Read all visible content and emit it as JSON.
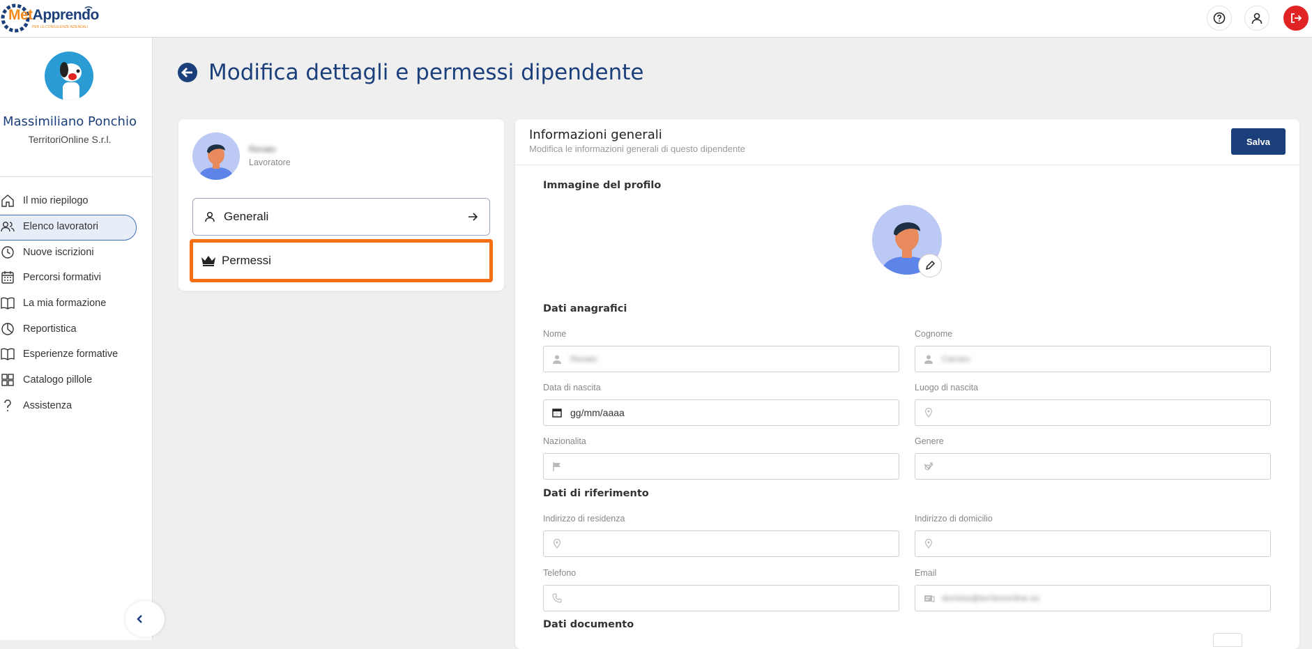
{
  "brand": {
    "logo_met": "Met",
    "logo_app": "Apprendo",
    "logo_sub": "PER LE CONSULENZE AZIENDALI"
  },
  "header": {
    "help_icon": "question-circle-icon",
    "account_icon": "user-icon",
    "logout_icon": "logout-icon",
    "logout_color": "#e02424"
  },
  "sidebar": {
    "user_name": "Massimiliano Ponchio",
    "company": "TerritoriOnline S.r.l.",
    "items": [
      {
        "label": "Il mio riepilogo",
        "icon": "home-icon"
      },
      {
        "label": "Elenco lavoratori",
        "icon": "users-icon",
        "active": true
      },
      {
        "label": "Nuove iscrizioni",
        "icon": "clock-icon"
      },
      {
        "label": "Percorsi formativi",
        "icon": "calendar-icon"
      },
      {
        "label": "La mia formazione",
        "icon": "book-icon"
      },
      {
        "label": "Reportistica",
        "icon": "pie-chart-icon"
      },
      {
        "label": "Esperienze formative",
        "icon": "book-open-icon"
      },
      {
        "label": "Catalogo pillole",
        "icon": "grid-icon"
      },
      {
        "label": "Assistenza",
        "icon": "question-icon"
      }
    ]
  },
  "page": {
    "title": "Modifica dettagli e permessi dipendente"
  },
  "employee_card": {
    "name": "Renato",
    "role": "Lavoratore",
    "nav": [
      {
        "label": "Generali",
        "icon": "user-icon"
      },
      {
        "label": "Permessi",
        "icon": "crown-icon",
        "highlight_color": "#f57013"
      }
    ]
  },
  "info": {
    "title": "Informazioni generali",
    "subtitle": "Modifica le informazioni generali di questo dipendente",
    "save_label": "Salva",
    "profile_image_label": "Immagine del profilo",
    "section_personal": "Dati anagrafici",
    "section_reference": "Dati di riferimento",
    "section_document": "Dati documento",
    "fields": {
      "nome": {
        "label": "Nome",
        "value": "Renato"
      },
      "cognome": {
        "label": "Cognome",
        "value": "Carraro"
      },
      "data_nascita": {
        "label": "Data di nascita",
        "value": "gg/mm/aaaa"
      },
      "luogo_nascita": {
        "label": "Luogo di nascita",
        "value": ""
      },
      "nazionalita": {
        "label": "Nazionalita",
        "value": ""
      },
      "genere": {
        "label": "Genere",
        "value": ""
      },
      "residenza": {
        "label": "Indirizzo di residenza",
        "value": ""
      },
      "domicilio": {
        "label": "Indirizzo di domicilio",
        "value": ""
      },
      "telefono": {
        "label": "Telefono",
        "value": ""
      },
      "email": {
        "label": "Email",
        "value": "dominio@territorionline.eu"
      }
    }
  },
  "colors": {
    "primary": "#1b3f7a",
    "accent": "#f08a1c"
  }
}
